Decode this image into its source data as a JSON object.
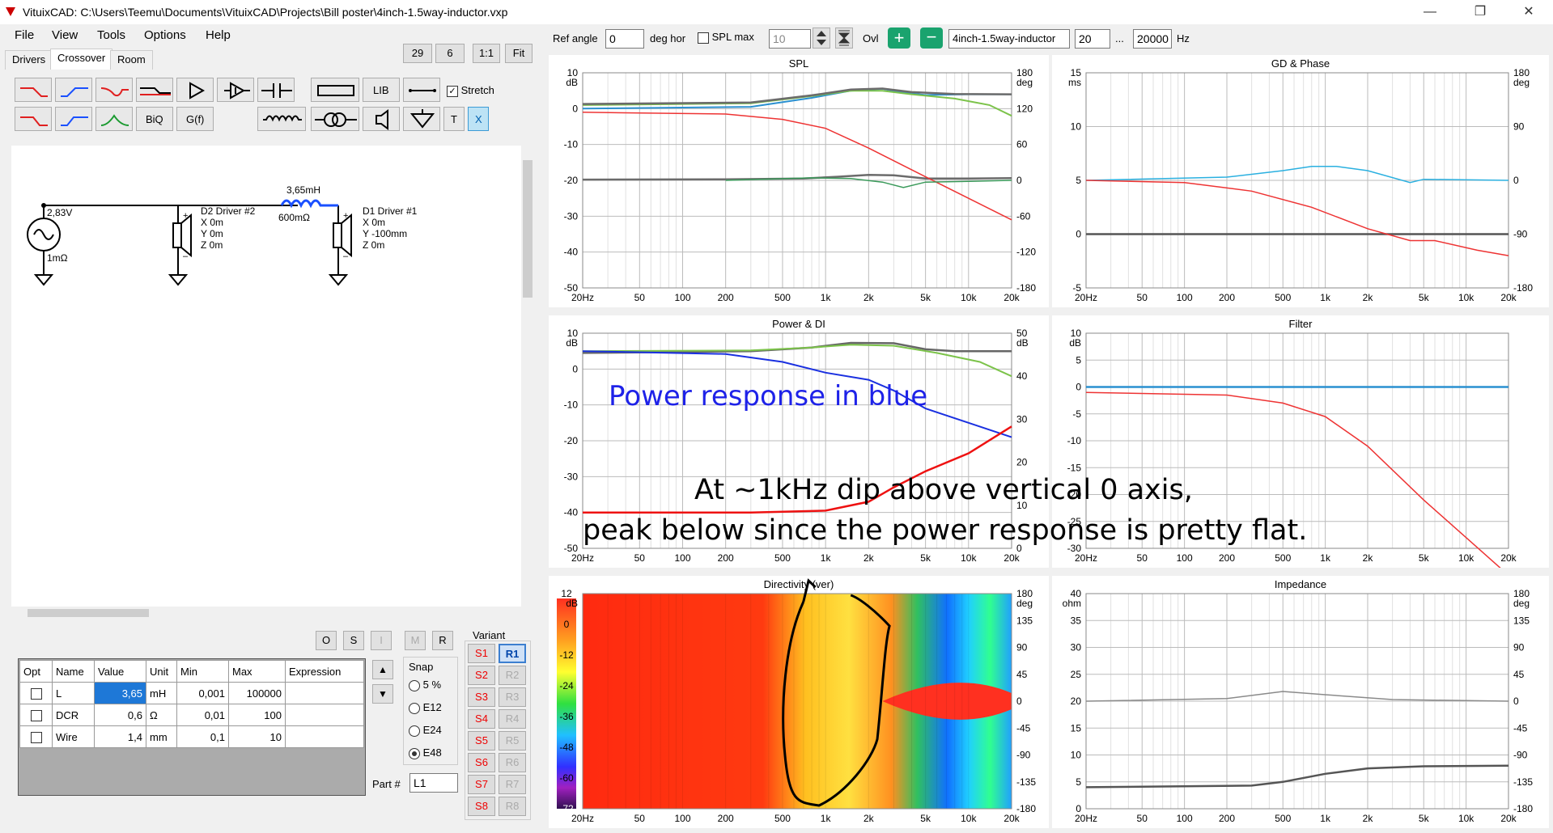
{
  "window": {
    "title": "VituixCAD: C:\\Users\\Teemu\\Documents\\VituixCAD\\Projects\\Bill poster\\4inch-1.5way-inductor.vxp"
  },
  "menu": [
    "File",
    "View",
    "Tools",
    "Options",
    "Help"
  ],
  "tabs": [
    "Drivers",
    "Crossover",
    "Room"
  ],
  "zoom": {
    "a": "29",
    "b": "6",
    "one": "1:1",
    "fit": "Fit"
  },
  "toolbar": {
    "lib": "LIB",
    "biq": "BiQ",
    "gf": "G(f)",
    "t": "T",
    "x": "X",
    "stretch": "Stretch"
  },
  "top": {
    "ref_angle_label": "Ref angle",
    "ref_angle_value": "0",
    "deg_hor": "deg hor",
    "spl_max": "SPL max",
    "spl_max_value": "10",
    "ovl": "Ovl",
    "project": "4inch-1.5way-inductor",
    "f_from": "20",
    "dots": "...",
    "f_to": "20000",
    "hz": "Hz"
  },
  "schematic": {
    "source_v": "2,83V",
    "source_r": "1mΩ",
    "inductor_l": "3,65mH",
    "inductor_r": "600mΩ",
    "d2": [
      "D2 Driver #2",
      "X 0m",
      "Y 0m",
      "Z 0m"
    ],
    "d1": [
      "D1 Driver #1",
      "X 0m",
      "Y -100mm",
      "Z 0m"
    ]
  },
  "osir": [
    "O",
    "S",
    "I",
    "M",
    "R"
  ],
  "params": {
    "headers": [
      "Opt",
      "Name",
      "Value",
      "Unit",
      "Min",
      "Max",
      "Expression"
    ],
    "rows": [
      [
        "",
        "L",
        "3,65",
        "mH",
        "0,001",
        "100000",
        ""
      ],
      [
        "",
        "DCR",
        "0,6",
        "Ω",
        "0,01",
        "100",
        ""
      ],
      [
        "",
        "Wire",
        "1,4",
        "mm",
        "0,1",
        "10",
        ""
      ]
    ]
  },
  "snap": {
    "label": "Snap",
    "options": [
      "5 %",
      "E12",
      "E24",
      "E48"
    ],
    "selected": "E48"
  },
  "part": {
    "label": "Part #",
    "value": "L1"
  },
  "variant": {
    "label": "Variant",
    "s": [
      "S1",
      "S2",
      "S3",
      "S4",
      "S5",
      "S6",
      "S7",
      "S8"
    ],
    "r": [
      "R1",
      "R2",
      "R3",
      "R4",
      "R5",
      "R6",
      "R7",
      "R8"
    ]
  },
  "x_ticks": [
    "20Hz",
    "50",
    "100",
    "200",
    "500",
    "1k",
    "2k",
    "5k",
    "10k",
    "20k"
  ],
  "charts": {
    "spl": {
      "title": "SPL",
      "yl": [
        "10",
        "0",
        "-10",
        "-20",
        "-30",
        "-40",
        "-50"
      ],
      "yl_unit": "dB",
      "yr": [
        "180",
        "120",
        "60",
        "0",
        "-60",
        "-120",
        "-180"
      ],
      "yr_unit": "deg"
    },
    "gd": {
      "title": "GD & Phase",
      "yl": [
        "15",
        "10",
        "5",
        "0",
        "-5"
      ],
      "yl_unit": "ms",
      "yr": [
        "180",
        "90",
        "0",
        "-90",
        "-180"
      ],
      "yr_unit": "deg"
    },
    "power": {
      "title": "Power & DI",
      "yl": [
        "10",
        "0",
        "-10",
        "-20",
        "-30",
        "-40",
        "-50"
      ],
      "yl_unit": "dB",
      "yr": [
        "50",
        "40",
        "30",
        "20",
        "10",
        "0"
      ],
      "yr_unit": "dB"
    },
    "filter": {
      "title": "Filter",
      "yl": [
        "10",
        "5",
        "0",
        "-5",
        "-10",
        "-15",
        "-20",
        "-25",
        "-30"
      ],
      "yl_unit": "dB"
    },
    "dir": {
      "title": "Directivity (ver)",
      "yl": [
        "12",
        "0",
        "-12",
        "-24",
        "-36",
        "-48",
        "-60",
        "-72"
      ],
      "yl_unit": "dB",
      "yr": [
        "180",
        "135",
        "90",
        "45",
        "0",
        "-45",
        "-90",
        "-135",
        "-180"
      ],
      "yr_unit": "deg"
    },
    "imp": {
      "title": "Impedance",
      "yl": [
        "40",
        "35",
        "30",
        "25",
        "20",
        "15",
        "10",
        "5",
        "0"
      ],
      "yl_unit": "ohm",
      "yr": [
        "180",
        "135",
        "90",
        "45",
        "0",
        "-45",
        "-90",
        "-135",
        "-180"
      ],
      "yr_unit": "deg"
    }
  },
  "annotations": {
    "power_blue": "Power response in blue",
    "line1": "At ~1kHz dip above vertical 0 axis,",
    "line2": "peak below since the power response is pretty flat."
  }
}
